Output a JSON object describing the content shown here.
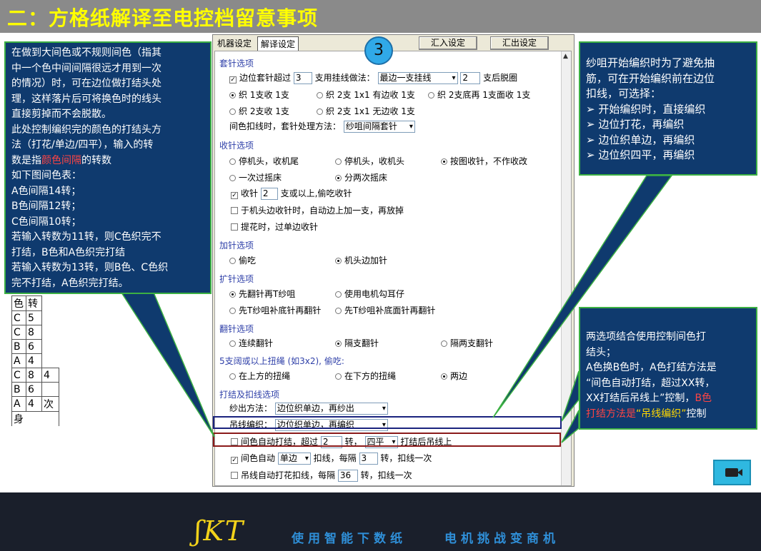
{
  "title": "二：方格纸解译至电控档留意事项",
  "footer": {
    "logo": "ʃKT",
    "slogan1": "使用智能下数纸",
    "slogan2": "电机挑战变商机"
  },
  "left_callout": {
    "lines": [
      "在做到大间色或不规则间色（指其",
      "中一个色中间间隔很远才用到一次",
      "的情况）时，可在边位做打结头处",
      "理，这样落片后可将换色时的线头",
      "直接剪掉而不会脱散。",
      "此处控制编织完的颜色的打结头方",
      "法（打花/单边/四平），输入的转"
    ],
    "line8_prefix": "数是指",
    "line8_red": "颜色间隔",
    "line8_suffix": "的转数",
    "lines2": [
      "如下图间色表：",
      "A色间隔14转；",
      "B色间隔12转；",
      "C色间隔10转；",
      "若输入转数为11转，则C色织完不",
      "打结，B色和A色织完打结",
      "若输入转数为13转，则B色、C色织",
      "完不打结，A色织完打结。"
    ]
  },
  "right_callout_top": {
    "lines": [
      "纱咀开始编织时为了避免抽",
      "筋，可在开始编织前在边位",
      "扣线，可选择："
    ],
    "bullets": [
      "开始编织时，直接编织",
      "边位打花，再编织",
      "边位织单边，再编织",
      "边位织四平，再编织"
    ]
  },
  "right_callout_bottom": {
    "line1": "两选项结合使用控制间色打",
    "line2": "结头；",
    "line3": "A色换B色时，A色打结方法是",
    "line4": "“间色自动打结，超过XX转，",
    "line5_white": "XX打结后吊线上”控制，",
    "line5_red": "B色",
    "line6_red": "打结方法是",
    "line6_yellow": "“吊线编织”",
    "line6_white": "控制"
  },
  "color_table": {
    "header": [
      "色",
      "转"
    ],
    "rows": [
      [
        "C",
        "5",
        ""
      ],
      [
        "C",
        "8",
        ""
      ],
      [
        "B",
        "6",
        ""
      ],
      [
        "A",
        "4",
        ""
      ],
      [
        "C",
        "8",
        "4"
      ],
      [
        "B",
        "6",
        ""
      ],
      [
        "A",
        "4",
        "次"
      ]
    ],
    "footer": "身"
  },
  "dialog": {
    "tab_machine": "机器设定",
    "tab_translate": "解译设定",
    "step": "3",
    "import_btn": "汇入设定",
    "export_btn": "汇出设定",
    "sec1": "套针选项",
    "edge_cover": "边位套针超过",
    "edge_cover_value": "3",
    "edge_cover_mid": "支用挂线做法：",
    "edge_cover_select": "最边一支挂线",
    "edge_cover_value2": "2",
    "edge_cover_end": "支后脱圈",
    "r1a": "织 1支收 1支",
    "r1b": "织 2支 1x1 有边收 1支",
    "r1c": "织 2支底再 1支面收 1支",
    "r2a": "织 2支收 1支",
    "r2b": "织 2支 1x1 无边收 1支",
    "gap_label": "间色扣线时，套针处理方法：",
    "gap_select": "纱咀间隔套针",
    "sec2": "收针选项",
    "s2a": "停机头，收机尾",
    "s2b": "停机头，收机头",
    "s2c": "按图收针，不作收改",
    "s2d": "一次过摇床",
    "s2e": "分两次摇床",
    "narrow_label": "收针",
    "narrow_value": "2",
    "narrow_end": "支或以上,偷吃收针",
    "narrow2": "于机头边收针时，自动边上加一支，再放掉",
    "narrow3": "提花时，过单边收针",
    "sec3": "加针选项",
    "s3a": "偷吃",
    "s3b": "机头边加针",
    "sec4": "扩针选项",
    "s4a": "先翻针再T纱咀",
    "s4b": "使用电机勾耳仔",
    "s4c": "先T纱咀补底针再翻针",
    "s4d": "先T纱咀补底面针再翻针",
    "sec5": "翻针选项",
    "s5a": "连续翻针",
    "s5b": "隔支翻针",
    "s5c": "隔两支翻针",
    "sec6": "5支阔或以上扭绳 (如3x2), 偷吃:",
    "s6a": "在上方的扭绳",
    "s6b": "在下方的扭绳",
    "s6c": "两边",
    "sec7": "打结及扣线选项",
    "yarn_out": "纱出方法：",
    "yarn_out_select": "边位织单边，再纱出",
    "hang_knit": "吊线编织：",
    "hang_knit_select": "边位织单边，再编织",
    "auto_knot": "间色自动打结，超过",
    "auto_knot_value": "2",
    "auto_knot_mid": "转，",
    "auto_knot_select": "四平",
    "auto_knot_end": "打结后吊线上",
    "auto_buckle": "间色自动",
    "auto_buckle_select": "单边",
    "auto_buckle_mid": "扣线，每隔",
    "auto_buckle_value": "3",
    "auto_buckle_end": "转，扣线一次",
    "hang_auto": "吊线自动打花扣线，每隔",
    "hang_auto_value": "36",
    "hang_auto_end": "转，扣线一次"
  }
}
